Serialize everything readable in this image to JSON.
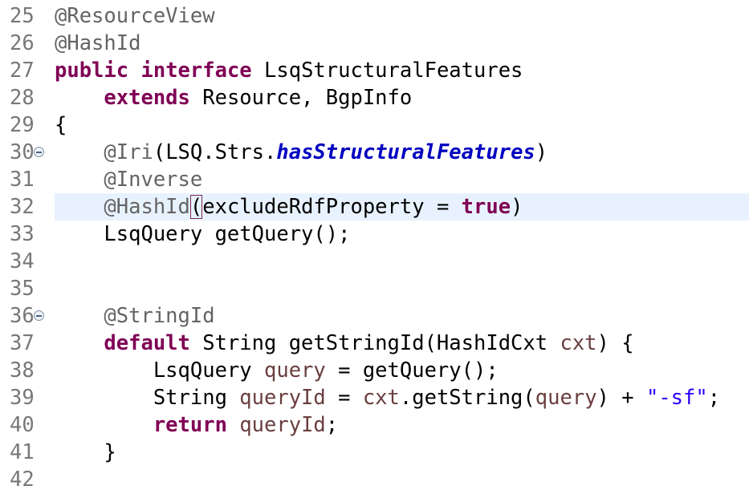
{
  "editor": {
    "lines": [
      {
        "num": "25",
        "tokens": [
          {
            "t": "@ResourceView",
            "c": "ann"
          }
        ]
      },
      {
        "num": "26",
        "tokens": [
          {
            "t": "@HashId",
            "c": "ann"
          }
        ]
      },
      {
        "num": "27",
        "tokens": [
          {
            "t": "public",
            "c": "kw"
          },
          {
            "t": " ",
            "c": "plain"
          },
          {
            "t": "interface",
            "c": "kw"
          },
          {
            "t": " LsqStructuralFeatures",
            "c": "plain"
          }
        ]
      },
      {
        "num": "28",
        "tokens": [
          {
            "t": "    ",
            "c": "plain"
          },
          {
            "t": "extends",
            "c": "kw"
          },
          {
            "t": " Resource, BgpInfo",
            "c": "plain"
          }
        ]
      },
      {
        "num": "29",
        "tokens": [
          {
            "t": "{",
            "c": "plain"
          }
        ]
      },
      {
        "num": "30",
        "fold": true,
        "tokens": [
          {
            "t": "    ",
            "c": "plain"
          },
          {
            "t": "@Iri",
            "c": "ann"
          },
          {
            "t": "(LSQ.Strs.",
            "c": "plain"
          },
          {
            "t": "hasStructuralFeatures",
            "c": "field"
          },
          {
            "t": ")",
            "c": "plain"
          }
        ]
      },
      {
        "num": "31",
        "tokens": [
          {
            "t": "    ",
            "c": "plain"
          },
          {
            "t": "@Inverse",
            "c": "ann"
          }
        ]
      },
      {
        "num": "32",
        "current": true,
        "tokens": [
          {
            "t": "    ",
            "c": "plain"
          },
          {
            "t": "@HashId",
            "c": "ann"
          },
          {
            "t": "(",
            "c": "plain bracket"
          },
          {
            "t": "excludeRdfProperty = ",
            "c": "plain"
          },
          {
            "t": "true",
            "c": "kw"
          },
          {
            "t": ")",
            "c": "plain"
          }
        ]
      },
      {
        "num": "33",
        "tokens": [
          {
            "t": "    LsqQuery getQuery();",
            "c": "plain"
          }
        ]
      },
      {
        "num": "34",
        "tokens": []
      },
      {
        "num": "35",
        "tokens": []
      },
      {
        "num": "36",
        "fold": true,
        "tokens": [
          {
            "t": "    ",
            "c": "plain"
          },
          {
            "t": "@StringId",
            "c": "ann"
          }
        ]
      },
      {
        "num": "37",
        "tokens": [
          {
            "t": "    ",
            "c": "plain"
          },
          {
            "t": "default",
            "c": "kw"
          },
          {
            "t": " String getStringId(HashIdCxt ",
            "c": "plain"
          },
          {
            "t": "cxt",
            "c": "local"
          },
          {
            "t": ") {",
            "c": "plain"
          }
        ]
      },
      {
        "num": "38",
        "tokens": [
          {
            "t": "        LsqQuery ",
            "c": "plain"
          },
          {
            "t": "query",
            "c": "local"
          },
          {
            "t": " = getQuery();",
            "c": "plain"
          }
        ]
      },
      {
        "num": "39",
        "tokens": [
          {
            "t": "        String ",
            "c": "plain"
          },
          {
            "t": "queryId",
            "c": "local"
          },
          {
            "t": " = ",
            "c": "plain"
          },
          {
            "t": "cxt",
            "c": "local"
          },
          {
            "t": ".getString(",
            "c": "plain"
          },
          {
            "t": "query",
            "c": "local"
          },
          {
            "t": ") + ",
            "c": "plain"
          },
          {
            "t": "\"-sf\"",
            "c": "str"
          },
          {
            "t": ";",
            "c": "plain"
          }
        ]
      },
      {
        "num": "40",
        "tokens": [
          {
            "t": "        ",
            "c": "plain"
          },
          {
            "t": "return",
            "c": "kw"
          },
          {
            "t": " ",
            "c": "plain"
          },
          {
            "t": "queryId",
            "c": "local"
          },
          {
            "t": ";",
            "c": "plain"
          }
        ]
      },
      {
        "num": "41",
        "tokens": [
          {
            "t": "    }",
            "c": "plain"
          }
        ]
      },
      {
        "num": "42",
        "tokens": []
      }
    ]
  }
}
